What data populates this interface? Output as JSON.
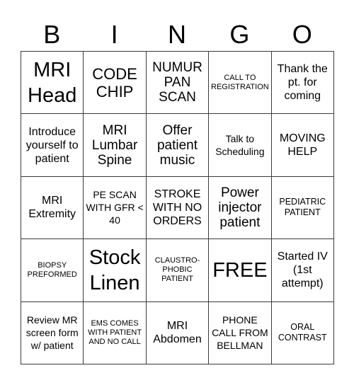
{
  "header": {
    "letters": [
      "B",
      "I",
      "N",
      "G",
      "O"
    ]
  },
  "card": {
    "rows": [
      [
        {
          "text": "MRI Head",
          "size": "s-xl"
        },
        {
          "text": "CODE CHIP",
          "size": "s-lg"
        },
        {
          "text": "NUMUR PAN SCAN",
          "size": "s-md"
        },
        {
          "text": "CALL TO REGISTRATION",
          "size": "s-tiny"
        },
        {
          "text": "Thank the pt. for coming",
          "size": "s-sm"
        }
      ],
      [
        {
          "text": "Introduce yourself to patient",
          "size": "s-sm"
        },
        {
          "text": "MRI Lumbar Spine",
          "size": "s-md"
        },
        {
          "text": "Offer patient music",
          "size": "s-md"
        },
        {
          "text": "Talk to Scheduling",
          "size": "s-xs"
        },
        {
          "text": "MOVING HELP",
          "size": "s-sm"
        }
      ],
      [
        {
          "text": "MRI Extremity",
          "size": "s-sm"
        },
        {
          "text": "PE SCAN WITH GFR < 40",
          "size": "s-xs"
        },
        {
          "text": "STROKE WITH NO ORDERS",
          "size": "s-sm"
        },
        {
          "text": "Power injector patient",
          "size": "s-md"
        },
        {
          "text": "PEDIATRIC PATIENT",
          "size": "s-xxs"
        }
      ],
      [
        {
          "text": "BIOPSY PREFORMED",
          "size": "s-tiny"
        },
        {
          "text": "Stock Linen",
          "size": "s-xl"
        },
        {
          "text": "CLAUSTRO-PHOBIC PATIENT",
          "size": "s-tiny"
        },
        {
          "text": "FREE",
          "size": "s-xl"
        },
        {
          "text": "Started IV (1st attempt)",
          "size": "s-sm"
        }
      ],
      [
        {
          "text": "Review MR screen form w/ patient",
          "size": "s-xs"
        },
        {
          "text": "EMS COMES WITH PATIENT AND NO CALL",
          "size": "s-tiny"
        },
        {
          "text": "MRI Abdomen",
          "size": "s-sm"
        },
        {
          "text": "PHONE CALL FROM BELLMAN",
          "size": "s-xs"
        },
        {
          "text": "ORAL CONTRAST",
          "size": "s-xxs"
        }
      ]
    ]
  },
  "colors": {
    "grid_line": "#3a3a3a",
    "text": "#000000",
    "background": "#ffffff"
  }
}
